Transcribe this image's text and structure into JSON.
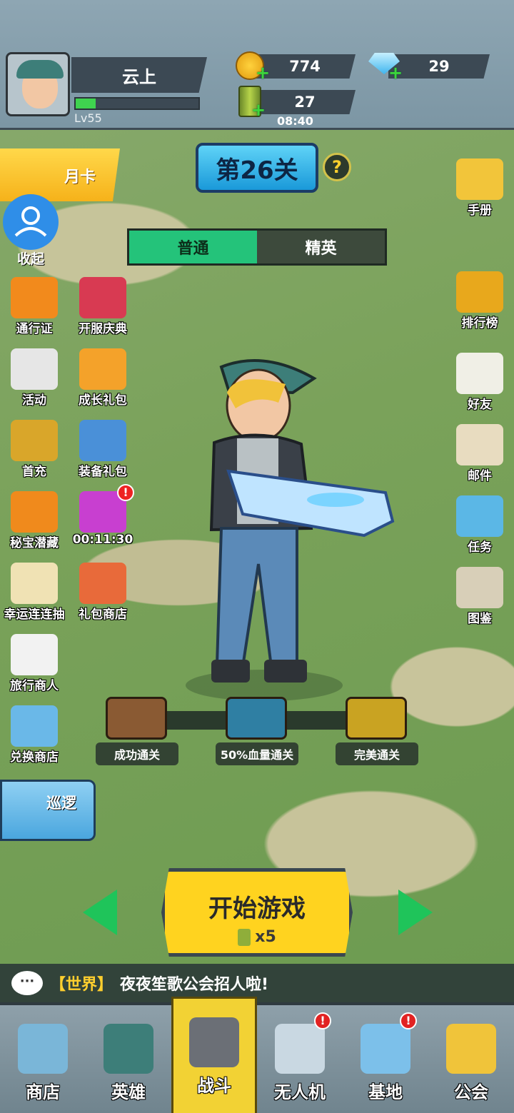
{
  "player": {
    "name": "云上",
    "level": "Lv55",
    "xp_progress": 0.16
  },
  "resources": {
    "coins": "774",
    "gems": "29",
    "energy": "27",
    "energy_timer": "08:40"
  },
  "stage": {
    "title": "第26关",
    "help": "?"
  },
  "difficulty_tabs": [
    {
      "label": "普通",
      "active": true
    },
    {
      "label": "精英",
      "active": false
    }
  ],
  "month_card": "月卡",
  "collapse": "收起",
  "left_menu": [
    {
      "label": "通行证",
      "icon": "pass-gift-icon"
    },
    {
      "label": "开服庆典",
      "icon": "celebration-chest-icon"
    },
    {
      "label": "活动",
      "icon": "activity-megaphone-icon"
    },
    {
      "label": "成长礼包",
      "icon": "growth-gift-icon"
    },
    {
      "label": "首充",
      "icon": "first-recharge-chest-icon"
    },
    {
      "label": "装备礼包",
      "icon": "equipment-gift-icon"
    },
    {
      "label": "秘宝潜藏",
      "icon": "mystery-gift-icon"
    },
    {
      "label": "00:11:30",
      "icon": "timed-gift-icon"
    },
    {
      "label": "幸运连连抽",
      "icon": "lucky-wheel-icon"
    },
    {
      "label": "礼包商店",
      "icon": "gift-shop-icon"
    },
    {
      "label": "旅行商人",
      "icon": "travel-merchant-icon"
    },
    {
      "label": "兑换商店",
      "icon": "exchange-shop-icon"
    }
  ],
  "patrol": "巡逻",
  "right_menu": [
    {
      "label": "手册",
      "icon": "handbook-icon"
    },
    {
      "label": "排行榜",
      "icon": "leaderboard-icon"
    },
    {
      "label": "好友",
      "icon": "friends-icon"
    },
    {
      "label": "邮件",
      "icon": "mail-icon"
    },
    {
      "label": "任务",
      "icon": "tasks-icon"
    },
    {
      "label": "图鉴",
      "icon": "collection-icon"
    }
  ],
  "rewards": [
    {
      "label": "成功通关",
      "color": "#8a5a33"
    },
    {
      "label": "50%血量通关",
      "color": "#2f7fa3"
    },
    {
      "label": "完美通关",
      "color": "#c9a322"
    }
  ],
  "start_button": {
    "label": "开始游戏",
    "cost": "x5"
  },
  "chat": {
    "channel": "【世界】",
    "message": "夜夜笙歌公会招人啦!"
  },
  "bottom_nav": [
    {
      "label": "商店",
      "icon": "shop-icon",
      "active": false,
      "alert": false
    },
    {
      "label": "英雄",
      "icon": "hero-icon",
      "active": false,
      "alert": false
    },
    {
      "label": "战斗",
      "icon": "rifle-icon",
      "active": true,
      "alert": false
    },
    {
      "label": "无人机",
      "icon": "drone-icon",
      "active": false,
      "alert": true
    },
    {
      "label": "基地",
      "icon": "base-dome-icon",
      "active": false,
      "alert": true
    },
    {
      "label": "公会",
      "icon": "guild-shield-icon",
      "active": false,
      "alert": false
    }
  ],
  "colors": {
    "accent_green": "#24c37a",
    "start_yellow": "#ffd31f",
    "alert_red": "#e22222"
  }
}
